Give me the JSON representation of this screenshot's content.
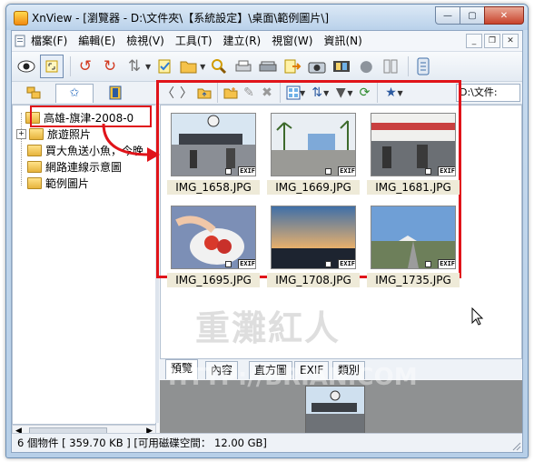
{
  "window": {
    "title": "XnView - [瀏覽器 - D:\\文件夾\\【系統設定】\\桌面\\範例圖片\\]"
  },
  "menu": [
    "檔案(F)",
    "編輯(E)",
    "檢視(V)",
    "工具(T)",
    "建立(R)",
    "視窗(W)",
    "資訊(N)"
  ],
  "toolbar": {
    "icons": [
      "view-icon",
      "fullscreen-icon",
      "rotate-left-icon",
      "rotate-right-icon",
      "flip-icon",
      "mark-icon",
      "open-folder-icon",
      "zoom-icon",
      "print-icon",
      "scanner-icon",
      "export-icon",
      "camera-icon",
      "filmstrip-icon",
      "web-icon",
      "compare-icon",
      "settings-icon"
    ]
  },
  "nav": {
    "path": "D:\\文件:"
  },
  "tree": [
    {
      "label": "高雄-旗津-2008-0",
      "selected": true
    },
    {
      "label": "旅遊照片"
    },
    {
      "label": "買大魚送小魚，今晚"
    },
    {
      "label": "網路連線示意圖"
    },
    {
      "label": "範例圖片"
    }
  ],
  "thumbnails": [
    {
      "filename": "IMG_1658.JPG",
      "badge": "EXIF"
    },
    {
      "filename": "IMG_1669.JPG",
      "badge": "EXIF"
    },
    {
      "filename": "IMG_1681.JPG",
      "badge": "EXIF"
    },
    {
      "filename": "IMG_1695.JPG",
      "badge": "EXIF"
    },
    {
      "filename": "IMG_1708.JPG",
      "badge": "EXIF"
    },
    {
      "filename": "IMG_1735.JPG",
      "badge": "EXIF"
    }
  ],
  "bottom_tabs": [
    "預覽",
    "內容",
    "直方圖",
    "EXIF",
    "類別"
  ],
  "watermark": {
    "text": "重灘紅人",
    "url": "HTTP://BRIAN.COM"
  },
  "status": "6 個物件 [ 359.70 KB ] [可用磁碟空間： 12.00 GB]",
  "colors": {
    "highlight": "#e0141a",
    "thumb_label_bg": "#eeead8"
  }
}
